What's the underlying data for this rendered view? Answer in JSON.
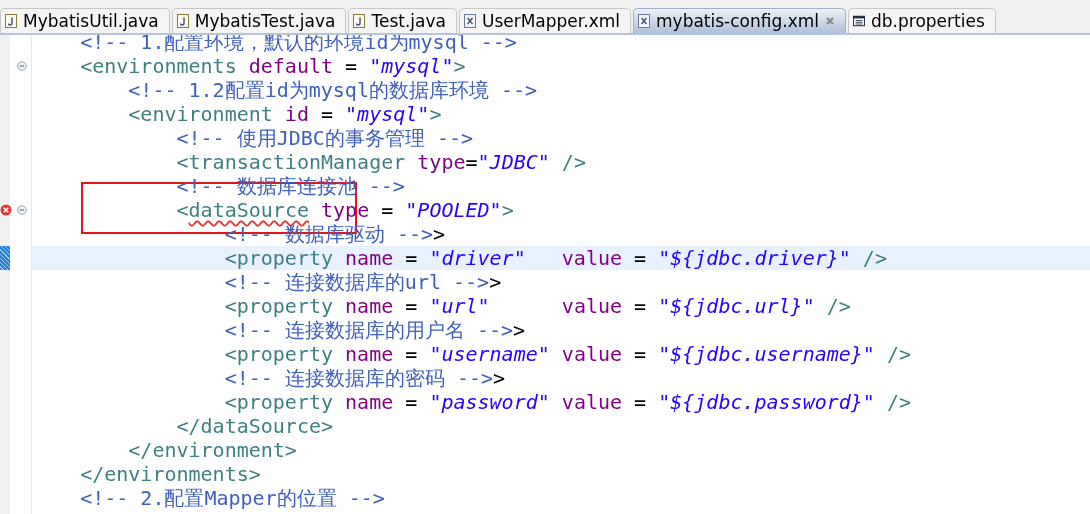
{
  "tabs": [
    {
      "label": "MybatisUtil.java",
      "kind": "java",
      "selected": false
    },
    {
      "label": "MybatisTest.java",
      "kind": "java",
      "selected": false
    },
    {
      "label": "Test.java",
      "kind": "java",
      "selected": false
    },
    {
      "label": "UserMapper.xml",
      "kind": "xml",
      "selected": false
    },
    {
      "label": "mybatis-config.xml",
      "kind": "xml",
      "selected": true
    },
    {
      "label": "db.properties",
      "kind": "properties",
      "selected": false
    }
  ],
  "editor": {
    "annotation_box": true,
    "lines": [
      {
        "foldable": false,
        "error": false,
        "current": false,
        "tokens": [
          {
            "kind": "comment",
            "text": "    <!-- 1.配置环境，默认的环境id为mysql -->"
          }
        ]
      },
      {
        "foldable": true,
        "error": false,
        "current": false,
        "tokens": [
          {
            "kind": "tag",
            "text": "    <environments"
          },
          {
            "kind": "attr",
            "text": " default"
          },
          {
            "kind": "op",
            "text": " = "
          },
          {
            "kind": "str",
            "text": "\"mysql\""
          },
          {
            "kind": "tag",
            "text": ">"
          }
        ]
      },
      {
        "foldable": false,
        "error": false,
        "current": false,
        "tokens": [
          {
            "kind": "comment",
            "text": "        <!-- 1.2配置id为mysql的数据库环境 -->"
          }
        ]
      },
      {
        "foldable": false,
        "error": false,
        "current": false,
        "tokens": [
          {
            "kind": "tag",
            "text": "        <environment"
          },
          {
            "kind": "attr",
            "text": " id"
          },
          {
            "kind": "op",
            "text": " = "
          },
          {
            "kind": "str",
            "text": "\"mysql\""
          },
          {
            "kind": "tag",
            "text": ">"
          }
        ]
      },
      {
        "foldable": false,
        "error": false,
        "current": false,
        "tokens": [
          {
            "kind": "comment",
            "text": "            <!-- 使用JDBC的事务管理 -->"
          }
        ]
      },
      {
        "foldable": false,
        "error": false,
        "current": false,
        "tokens": [
          {
            "kind": "tag",
            "text": "            <transactionManager"
          },
          {
            "kind": "attr",
            "text": " type"
          },
          {
            "kind": "op",
            "text": "="
          },
          {
            "kind": "str",
            "text": "\"JDBC\""
          },
          {
            "kind": "tag",
            "text": " />"
          }
        ]
      },
      {
        "foldable": false,
        "error": false,
        "current": false,
        "tokens": [
          {
            "kind": "comment",
            "text": "            <!-- 数据库连接池 -->"
          }
        ]
      },
      {
        "foldable": true,
        "error": true,
        "current": false,
        "tokens": [
          {
            "kind": "tag",
            "text": "            <"
          },
          {
            "kind": "tag",
            "text": "dataSource",
            "squiggle": true
          },
          {
            "kind": "attr",
            "text": " type"
          },
          {
            "kind": "op",
            "text": " = "
          },
          {
            "kind": "str",
            "text": "\"POOLED\""
          },
          {
            "kind": "tag",
            "text": ">"
          }
        ]
      },
      {
        "foldable": false,
        "error": false,
        "current": false,
        "tokens": [
          {
            "kind": "comment",
            "text": "                <!-- 数据库驱动 -->"
          },
          {
            "kind": "op",
            "text": ">"
          }
        ]
      },
      {
        "foldable": false,
        "error": false,
        "current": true,
        "tokens": [
          {
            "kind": "tag",
            "text": "                <property"
          },
          {
            "kind": "attr",
            "text": " name"
          },
          {
            "kind": "op",
            "text": " = "
          },
          {
            "kind": "str",
            "text": "\"driver\""
          },
          {
            "kind": "attr",
            "text": "   value"
          },
          {
            "kind": "op",
            "text": " = "
          },
          {
            "kind": "str",
            "text": "\"${jdbc.driver}\""
          },
          {
            "kind": "tag",
            "text": " />"
          }
        ]
      },
      {
        "foldable": false,
        "error": false,
        "current": false,
        "tokens": [
          {
            "kind": "comment",
            "text": "                <!-- 连接数据库的url -->"
          },
          {
            "kind": "op",
            "text": ">"
          }
        ]
      },
      {
        "foldable": false,
        "error": false,
        "current": false,
        "tokens": [
          {
            "kind": "tag",
            "text": "                <property"
          },
          {
            "kind": "attr",
            "text": " name"
          },
          {
            "kind": "op",
            "text": " = "
          },
          {
            "kind": "str",
            "text": "\"url\""
          },
          {
            "kind": "attr",
            "text": "      value"
          },
          {
            "kind": "op",
            "text": " = "
          },
          {
            "kind": "str",
            "text": "\"${jdbc.url}\""
          },
          {
            "kind": "tag",
            "text": " />"
          }
        ]
      },
      {
        "foldable": false,
        "error": false,
        "current": false,
        "tokens": [
          {
            "kind": "comment",
            "text": "                <!-- 连接数据库的用户名 -->"
          },
          {
            "kind": "op",
            "text": ">"
          }
        ]
      },
      {
        "foldable": false,
        "error": false,
        "current": false,
        "tokens": [
          {
            "kind": "tag",
            "text": "                <property"
          },
          {
            "kind": "attr",
            "text": " name"
          },
          {
            "kind": "op",
            "text": " = "
          },
          {
            "kind": "str",
            "text": "\"username\""
          },
          {
            "kind": "attr",
            "text": " value"
          },
          {
            "kind": "op",
            "text": " = "
          },
          {
            "kind": "str",
            "text": "\"${jdbc.username}\""
          },
          {
            "kind": "tag",
            "text": " />"
          }
        ]
      },
      {
        "foldable": false,
        "error": false,
        "current": false,
        "tokens": [
          {
            "kind": "comment",
            "text": "                <!-- 连接数据库的密码 -->"
          },
          {
            "kind": "op",
            "text": ">"
          }
        ]
      },
      {
        "foldable": false,
        "error": false,
        "current": false,
        "tokens": [
          {
            "kind": "tag",
            "text": "                <property"
          },
          {
            "kind": "attr",
            "text": " name"
          },
          {
            "kind": "op",
            "text": " = "
          },
          {
            "kind": "str",
            "text": "\"password\""
          },
          {
            "kind": "attr",
            "text": " value"
          },
          {
            "kind": "op",
            "text": " = "
          },
          {
            "kind": "str",
            "text": "\"${jdbc.password}\""
          },
          {
            "kind": "tag",
            "text": " />"
          }
        ]
      },
      {
        "foldable": false,
        "error": false,
        "current": false,
        "tokens": [
          {
            "kind": "tag",
            "text": "            </dataSource>"
          }
        ]
      },
      {
        "foldable": false,
        "error": false,
        "current": false,
        "tokens": [
          {
            "kind": "tag",
            "text": "        </environment>"
          }
        ]
      },
      {
        "foldable": false,
        "error": false,
        "current": false,
        "tokens": [
          {
            "kind": "tag",
            "text": "    </environments>"
          }
        ]
      },
      {
        "foldable": false,
        "error": false,
        "current": false,
        "tokens": [
          {
            "kind": "comment",
            "text": "    <!-- 2.配置Mapper的位置 -->"
          }
        ]
      }
    ]
  }
}
